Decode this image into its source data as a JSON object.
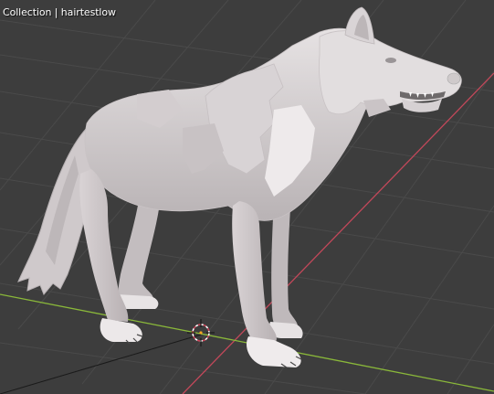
{
  "viewport": {
    "overlay_text": "Collection | hairtestlow",
    "background": "#3d3d3d",
    "grid_color": "#4a4a4a",
    "x_axis_color": "#c2485a",
    "y_axis_color": "#8ab83a"
  },
  "scene": {
    "object_icon": "wolf-mesh",
    "origin_icon": "3d-cursor-icon"
  }
}
